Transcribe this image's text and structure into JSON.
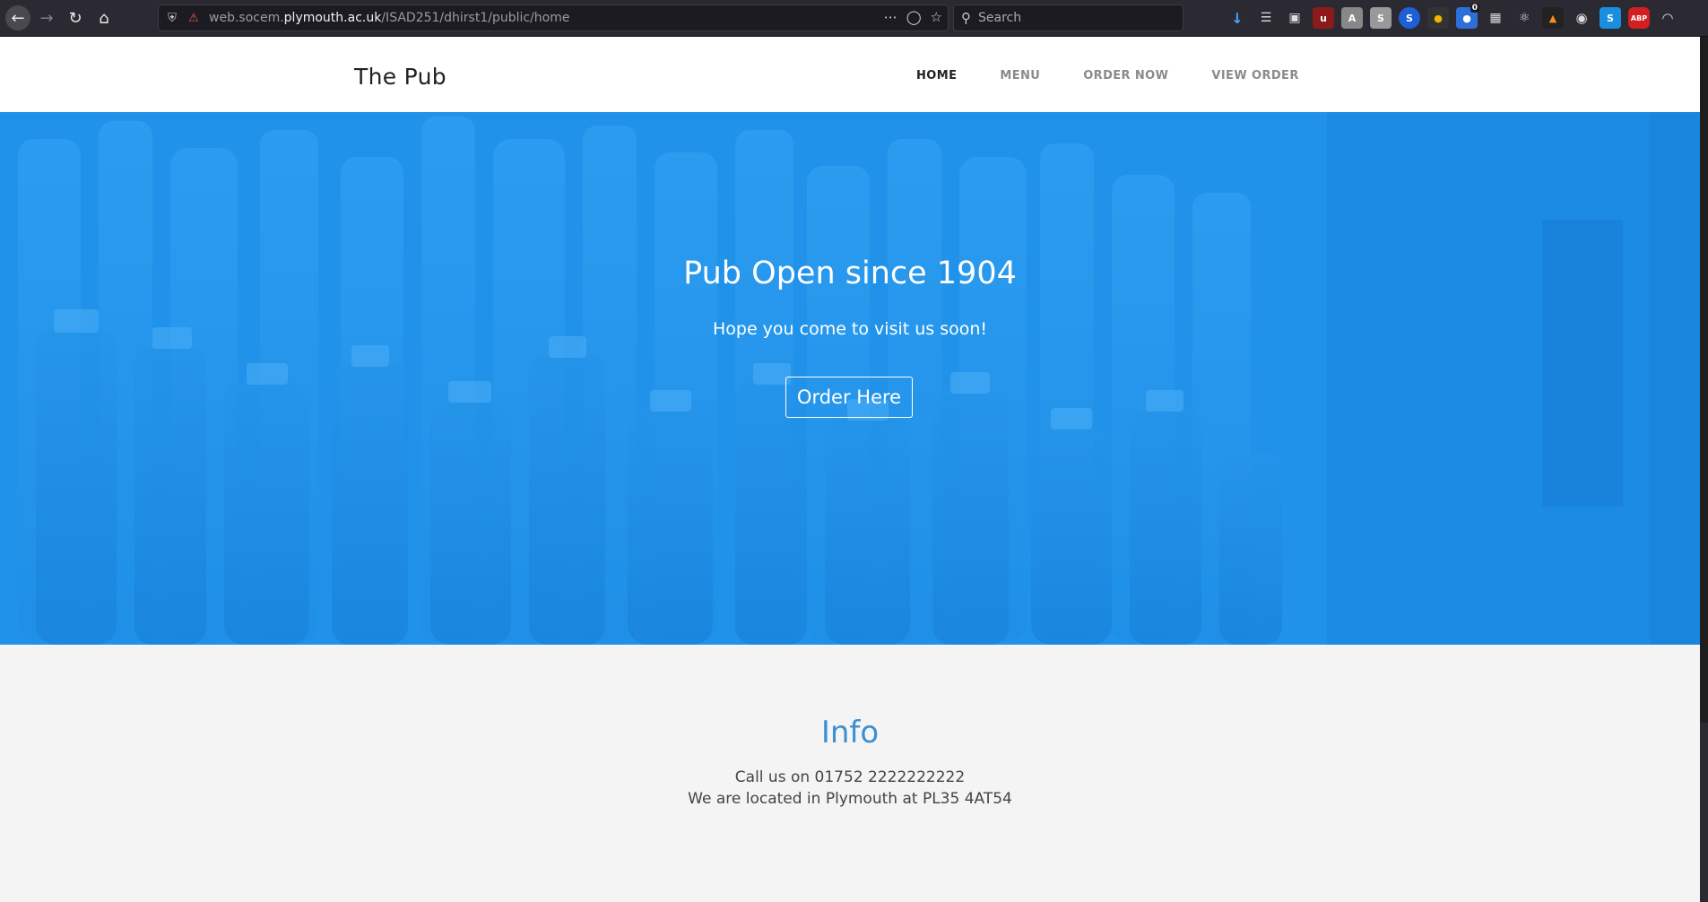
{
  "browser": {
    "url_prefix": "web.socem.",
    "url_domain": "plymouth.ac.uk",
    "url_path": "/ISAD251/dhirst1/public/home",
    "search_placeholder": "Search",
    "extension_badge": "0"
  },
  "site": {
    "brand": "The Pub",
    "nav": [
      {
        "label": "HOME",
        "active": true
      },
      {
        "label": "MENU",
        "active": false
      },
      {
        "label": "ORDER NOW",
        "active": false
      },
      {
        "label": "VIEW ORDER",
        "active": false
      }
    ]
  },
  "hero": {
    "title": "Pub Open since 1904",
    "subtitle": "Hope you come to visit us soon!",
    "button": "Order Here"
  },
  "info": {
    "title": "Info",
    "phone_line": "Call us on 01752 2222222222",
    "location_line": "We are located in Plymouth at PL35 4AT54"
  },
  "colors": {
    "hero_blue": "#1a93e8",
    "info_title": "#3b8fd4",
    "chrome_bg": "#2b2a33"
  }
}
